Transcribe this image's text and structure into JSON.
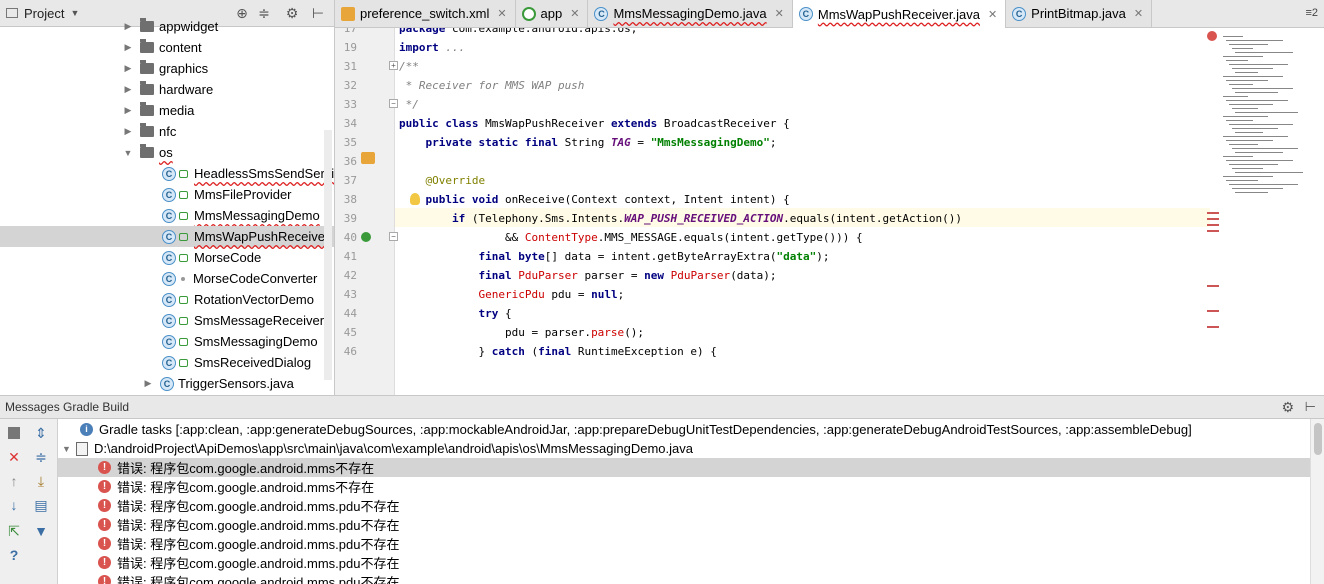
{
  "project_pane": {
    "title": "Project",
    "tree": [
      {
        "label": "appwidget",
        "kind": "folder",
        "expanded": false,
        "cut": true
      },
      {
        "label": "content",
        "kind": "folder",
        "expanded": false
      },
      {
        "label": "graphics",
        "kind": "folder",
        "expanded": false
      },
      {
        "label": "hardware",
        "kind": "folder",
        "expanded": false
      },
      {
        "label": "media",
        "kind": "folder",
        "expanded": false
      },
      {
        "label": "nfc",
        "kind": "folder",
        "expanded": false
      },
      {
        "label": "os",
        "kind": "folder",
        "expanded": true,
        "error": true
      },
      {
        "label": "HeadlessSmsSendService",
        "kind": "class",
        "error": true
      },
      {
        "label": "MmsFileProvider",
        "kind": "class"
      },
      {
        "label": "MmsMessagingDemo",
        "kind": "class",
        "error": true
      },
      {
        "label": "MmsWapPushReceiver",
        "kind": "class",
        "error": true,
        "selected": true
      },
      {
        "label": "MorseCode",
        "kind": "class"
      },
      {
        "label": "MorseCodeConverter",
        "kind": "class-plain"
      },
      {
        "label": "RotationVectorDemo",
        "kind": "class"
      },
      {
        "label": "SmsMessageReceiver",
        "kind": "class"
      },
      {
        "label": "SmsMessagingDemo",
        "kind": "class"
      },
      {
        "label": "SmsReceivedDialog",
        "kind": "class"
      },
      {
        "label": "TriggerSensors.java",
        "kind": "file"
      }
    ]
  },
  "tabs": [
    {
      "label": "preference_switch.xml",
      "icon": "xml-file-icon",
      "active": false,
      "error": false
    },
    {
      "label": "app",
      "icon": "gradle-module-icon",
      "active": false,
      "error": false
    },
    {
      "label": "MmsMessagingDemo.java",
      "icon": "class-icon",
      "active": false,
      "error": true
    },
    {
      "label": "MmsWapPushReceiver.java",
      "icon": "class-icon",
      "active": true,
      "error": true
    },
    {
      "label": "PrintBitmap.java",
      "icon": "class-icon",
      "active": false,
      "error": false
    }
  ],
  "tabs_overflow": "≡2",
  "code_lines": [
    {
      "n": "17",
      "html": "<span class=\"kw\">package</span> com.example.android.apis.os;"
    },
    {
      "n": "19",
      "html": "<span class=\"kw\">import</span> <span class=\"cm\">...</span>"
    },
    {
      "n": "31",
      "html": "<span class=\"cm\">/**</span>"
    },
    {
      "n": "32",
      "html": "<span class=\"cm\"> * Receiver for MMS WAP push</span>"
    },
    {
      "n": "33",
      "html": "<span class=\"cm\"> */</span>"
    },
    {
      "n": "34",
      "html": "<span class=\"kw\">public class</span> MmsWapPushReceiver <span class=\"kw\">extends</span> BroadcastReceiver {"
    },
    {
      "n": "35",
      "html": "    <span class=\"kw\">private static final</span> String <span class=\"cn\">TAG</span> = <span class=\"st\">\"MmsMessagingDemo\"</span>;"
    },
    {
      "n": "36",
      "html": ""
    },
    {
      "n": "37",
      "html": "    <span class=\"an\">@Override</span>"
    },
    {
      "n": "38",
      "html": "    <span class=\"kw\">public void</span> onReceive(Context context, Intent intent) {"
    },
    {
      "n": "39",
      "html": "        <span class=\"kw\">if</span> (Telephony.Sms.Intents.<span class=\"cn\">WAP_PUSH_RECEIVED_ACTION</span>.equals(intent.getAction())"
    },
    {
      "n": "40",
      "html": "                &amp;&amp; <span class=\"er\">ContentType</span>.MMS_MESSAGE.equals(intent.getType())) {"
    },
    {
      "n": "41",
      "html": "            <span class=\"kw\">final byte</span>[] data = intent.getByteArrayExtra(<span class=\"st\">\"data\"</span>);"
    },
    {
      "n": "42",
      "html": "            <span class=\"kw\">final</span> <span class=\"er\">PduParser</span> parser = <span class=\"kw\">new</span> <span class=\"er\">PduParser</span>(data);"
    },
    {
      "n": "43",
      "html": "            <span class=\"er\">GenericPdu</span> pdu = <span class=\"kw\">null</span>;"
    },
    {
      "n": "44",
      "html": "            <span class=\"kw\">try</span> {"
    },
    {
      "n": "45",
      "html": "                pdu = parser.<span class=\"er\">parse</span>();"
    },
    {
      "n": "46",
      "html": "            } <span class=\"kw\">catch</span> (<span class=\"kw\">final</span> RuntimeException e) {"
    }
  ],
  "messages": {
    "title": "Messages Gradle Build",
    "rows": [
      {
        "type": "info",
        "text": "Gradle tasks [:app:clean, :app:generateDebugSources, :app:mockableAndroidJar, :app:prepareDebugUnitTestDependencies, :app:generateDebugAndroidTestSources, :app:assembleDebug]"
      },
      {
        "type": "file",
        "text": "D:\\androidProject\\ApiDemos\\app\\src\\main\\java\\com\\example\\android\\apis\\os\\MmsMessagingDemo.java"
      },
      {
        "type": "error",
        "text": "错误: 程序包com.google.android.mms不存在",
        "selected": true
      },
      {
        "type": "error",
        "text": "错误: 程序包com.google.android.mms不存在"
      },
      {
        "type": "error",
        "text": "错误: 程序包com.google.android.mms.pdu不存在"
      },
      {
        "type": "error",
        "text": "错误: 程序包com.google.android.mms.pdu不存在"
      },
      {
        "type": "error",
        "text": "错误: 程序包com.google.android.mms.pdu不存在"
      },
      {
        "type": "error",
        "text": "错误: 程序包com.google.android.mms.pdu不存在"
      },
      {
        "type": "error",
        "text": "错误: 程序包com.google.android.mms.pdu不存在"
      }
    ]
  }
}
